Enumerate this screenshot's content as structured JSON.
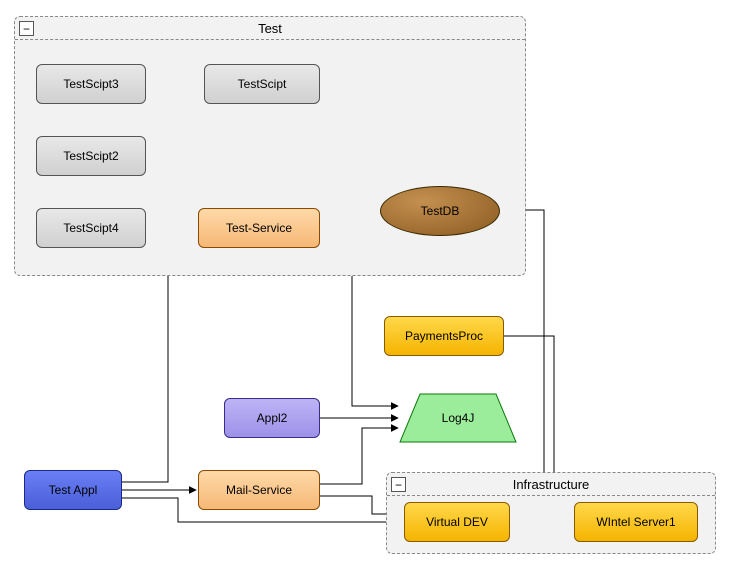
{
  "groups": {
    "test": {
      "label": "Test",
      "collapse": "−"
    },
    "infra": {
      "label": "Infrastructure",
      "collapse": "−"
    }
  },
  "nodes": {
    "testScript3": "TestScipt3",
    "testScript2": "TestScipt2",
    "testScript4": "TestScipt4",
    "testScript": "TestScipt",
    "testService": "Test-Service",
    "testDB": "TestDB",
    "paymentsProc": "PaymentsProc",
    "appl2": "Appl2",
    "log4j": "Log4J",
    "testAppl": "Test Appl",
    "mailService": "Mail-Service",
    "virtualDev": "Virtual DEV",
    "wintelServer": "WIntel Server1"
  },
  "colors": {
    "grey": "#d8d8d8",
    "orangeLight": "#f5c388",
    "orange": "#f5c030",
    "purple": "#a89de8",
    "blue": "#5a70e8",
    "brown": "#9a6a30",
    "green": "#90ee90"
  },
  "edges": [
    [
      "testScript3",
      "testScript"
    ],
    [
      "testAppl",
      "testScript"
    ],
    [
      "testAppl",
      "mailService"
    ],
    [
      "testAppl",
      "virtualDev"
    ],
    [
      "testService",
      "testDB"
    ],
    [
      "testService",
      "log4j"
    ],
    [
      "appl2",
      "log4j"
    ],
    [
      "mailService",
      "log4j"
    ],
    [
      "mailService",
      "virtualDev"
    ],
    [
      "paymentsProc",
      "wintelServer"
    ],
    [
      "testDB",
      "wintelServer"
    ],
    [
      "virtualDev",
      "wintelServer"
    ]
  ]
}
